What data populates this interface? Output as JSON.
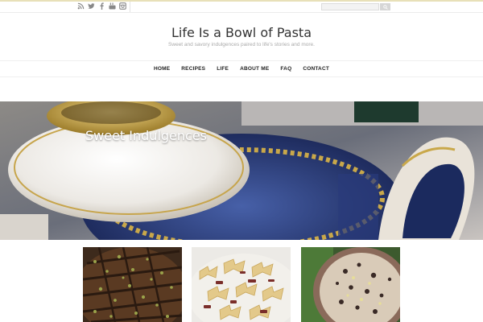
{
  "topbar": {
    "social_icons": [
      "rss-icon",
      "twitter-icon",
      "facebook-icon",
      "youtube-icon",
      "instagram-icon"
    ],
    "search": {
      "value": "",
      "placeholder": ""
    }
  },
  "site": {
    "title": "Life Is a Bowl of Pasta",
    "tagline": "Sweet and savory indulgences paired to life's stories and more."
  },
  "nav": {
    "items": [
      "HOME",
      "RECIPES",
      "LIFE",
      "ABOUT ME",
      "FAQ",
      "CONTACT"
    ]
  },
  "hero": {
    "title": "Sweet Indulgences"
  },
  "colors": {
    "accent_line": "#e8e0b8",
    "text_dark": "#333333",
    "tagline_gray": "#aaaaaa"
  }
}
